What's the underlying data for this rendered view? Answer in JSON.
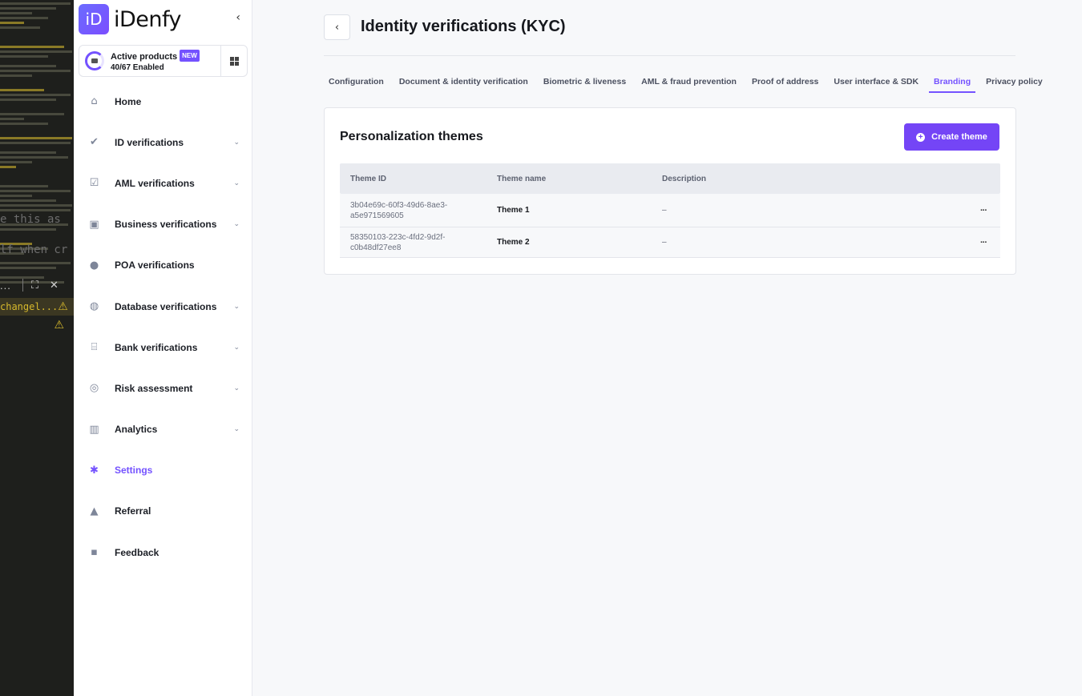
{
  "editor": {
    "line_a": "e this as",
    "line_b": "lf when cr",
    "bar_dots": "...",
    "expand_icon": "expand-icon",
    "close_icon": "close-icon",
    "warn_text": "changel...",
    "warn_icon": "warning-icon"
  },
  "sidebar": {
    "logo_mark": "iD",
    "logo_text": "iDenfy",
    "collapse": "‹",
    "products": {
      "title": "Active products",
      "badge": "NEW",
      "count": "40/67 Enabled"
    },
    "items": [
      {
        "label": "Home",
        "icon": "home-icon",
        "has_chevron": false
      },
      {
        "label": "ID verifications",
        "icon": "user-check-icon",
        "has_chevron": true
      },
      {
        "label": "AML verifications",
        "icon": "clipboard-check-icon",
        "has_chevron": true
      },
      {
        "label": "Business verifications",
        "icon": "briefcase-icon",
        "has_chevron": true
      },
      {
        "label": "POA verifications",
        "icon": "location-pin-icon",
        "has_chevron": false
      },
      {
        "label": "Database verifications",
        "icon": "globe-icon",
        "has_chevron": true
      },
      {
        "label": "Bank verifications",
        "icon": "bank-icon",
        "has_chevron": true
      },
      {
        "label": "Risk assessment",
        "icon": "target-icon",
        "has_chevron": true
      },
      {
        "label": "Analytics",
        "icon": "bar-chart-icon",
        "has_chevron": true
      },
      {
        "label": "Settings",
        "icon": "gear-icon",
        "has_chevron": false,
        "active": true
      },
      {
        "label": "Referral",
        "icon": "rocket-icon",
        "has_chevron": false
      },
      {
        "label": "Feedback",
        "icon": "feedback-icon",
        "has_chevron": false
      }
    ]
  },
  "header": {
    "back": "‹",
    "title": "Identity verifications (KYC)"
  },
  "tabs": [
    {
      "label": "Configuration"
    },
    {
      "label": "Document & identity verification"
    },
    {
      "label": "Biometric & liveness"
    },
    {
      "label": "AML & fraud prevention"
    },
    {
      "label": "Proof of address"
    },
    {
      "label": "User interface & SDK"
    },
    {
      "label": "Branding",
      "active": true
    },
    {
      "label": "Privacy policy"
    }
  ],
  "themes": {
    "title": "Personalization themes",
    "create_label": "Create theme",
    "columns": [
      "Theme ID",
      "Theme name",
      "Description"
    ],
    "rows": [
      {
        "id_line1": "3b04e69c-60f3-49d6-8ae3-",
        "id_line2": "a5e971569605",
        "name": "Theme 1",
        "description": "–"
      },
      {
        "id_line1": "58350103-223c-4fd2-9d2f-",
        "id_line2": "c0b48df27ee8",
        "name": "Theme 2",
        "description": "–"
      }
    ],
    "more_label": "···"
  },
  "colors": {
    "accent": "#7452ff",
    "button": "#7445f6",
    "editor_bg": "#1e1f1c",
    "warning": "#d7b92c"
  }
}
